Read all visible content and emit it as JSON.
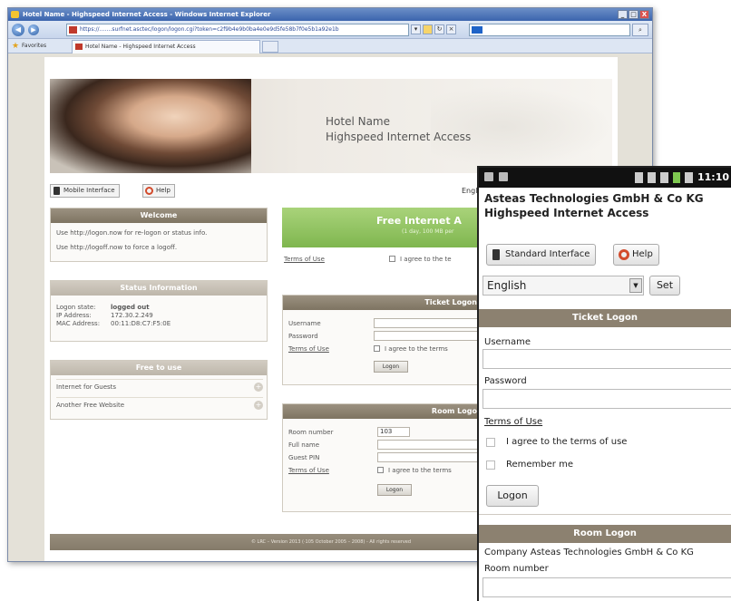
{
  "browser": {
    "title": "Hotel Name - Highspeed Internet Access - Windows Internet Explorer",
    "window_controls": [
      "_",
      "□",
      "X"
    ],
    "url": "https://…….surfnet.asctec/logon/logon.cgi?token=c2f9b4e9b0ba4e0e9d5fe58b7f0e5b1a92e1b",
    "favorites_label": "Favorites",
    "tab_label": "Hotel Name - Highspeed Internet Access"
  },
  "desktop": {
    "banner": {
      "title": "Hotel Name",
      "subtitle": "Highspeed Internet Access"
    },
    "mobile_interface_label": "Mobile Interface",
    "help_label": "Help",
    "language_partial": "Engli",
    "welcome": {
      "title": "Welcome",
      "line1": "Use http://logon.now for re-logon or status info.",
      "line2": "Use http://logoff.now to force a logoff."
    },
    "status": {
      "title": "Status Information",
      "logon_state_label": "Logon state:",
      "logon_state_value": "logged out",
      "ip_label": "IP Address:",
      "ip_value": "172.30.2.249",
      "mac_label": "MAC Address:",
      "mac_value": "00:11:D8:C7:F5:0E"
    },
    "free_to_use": {
      "title": "Free to use",
      "items": [
        "Internet for Guests",
        "Another Free Website"
      ]
    },
    "free_internet": {
      "title": "Free Internet A",
      "subtitle": "(1 day, 100 MB per"
    },
    "terms_link": "Terms of Use",
    "agree_partial": "I agree to the te",
    "ticket": {
      "title": "Ticket Logon",
      "username_label": "Username",
      "password_label": "Password",
      "terms_link": "Terms of Use",
      "agree_partial": "I agree to the terms",
      "logon_label": "Logon"
    },
    "room": {
      "title": "Room Logo",
      "room_number_label": "Room number",
      "room_number_value": "103",
      "full_name_label": "Full name",
      "guest_pin_label": "Guest PIN",
      "terms_link": "Terms of Use",
      "agree_partial": "I agree to the terms",
      "logon_label": "Logon"
    },
    "footer": "© LRC – Version 2013 (·105 October 2005 – 2008) - All rights reserved"
  },
  "mobile": {
    "clock": "11:10",
    "title_line1": "Asteas Technologies GmbH & Co KG",
    "title_line2": "Highspeed Internet Access",
    "standard_interface_label": "Standard Interface",
    "help_label": "Help",
    "language_value": "English",
    "set_label": "Set",
    "ticket": {
      "title": "Ticket Logon",
      "username_label": "Username",
      "password_label": "Password",
      "terms_link": "Terms of Use",
      "agree_label": "I agree to the terms of use",
      "remember_label": "Remember me",
      "logon_label": "Logon"
    },
    "room": {
      "title": "Room Logon",
      "company_line": "Company Asteas Technologies GmbH & Co KG",
      "room_number_label": "Room number"
    }
  },
  "colors": {
    "panel_header": "#8c8170",
    "green_accent": "#8dc15e",
    "ie_title_blue": "#3b64ad"
  }
}
